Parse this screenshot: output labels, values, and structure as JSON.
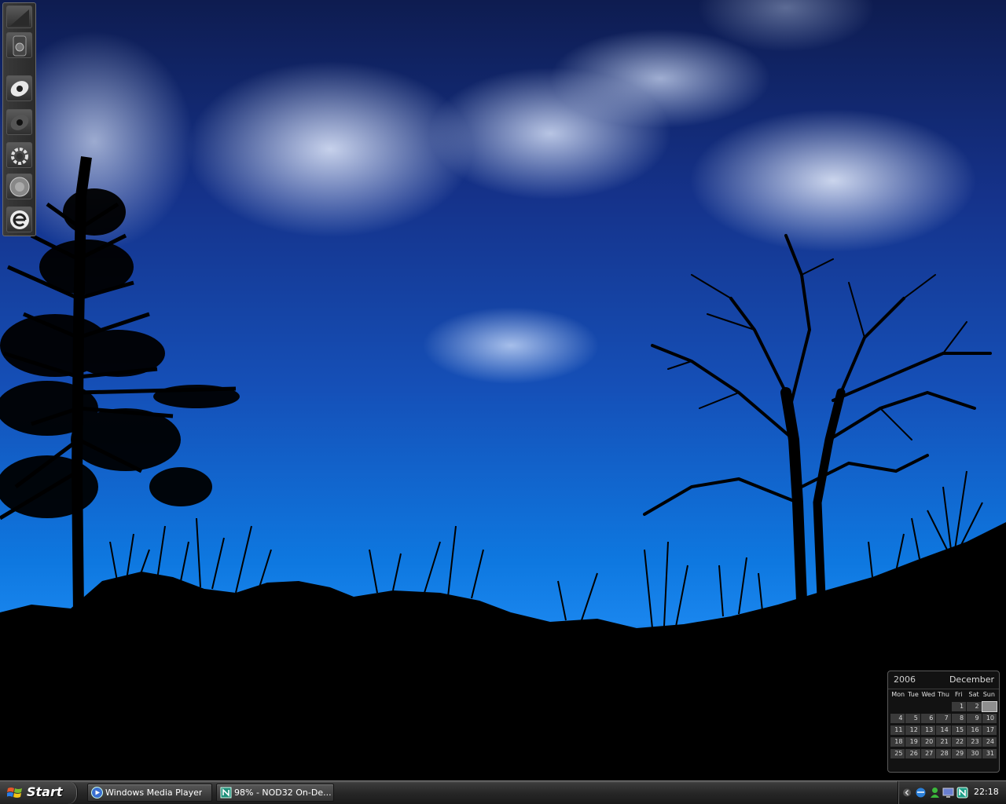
{
  "dock": {
    "items": [
      "ipod-icon",
      "eye-icon",
      "eye-dark-icon",
      "gear-icon",
      "globe-icon",
      "ie-icon"
    ]
  },
  "calendar": {
    "year": "2006",
    "month": "December",
    "days": [
      "Mon",
      "Tue",
      "Wed",
      "Thu",
      "Fri",
      "Sat",
      "Sun"
    ],
    "dates": [
      "",
      "",
      "",
      "",
      "1",
      "2",
      "3",
      "4",
      "5",
      "6",
      "7",
      "8",
      "9",
      "10",
      "11",
      "12",
      "13",
      "14",
      "15",
      "16",
      "17",
      "18",
      "19",
      "20",
      "21",
      "22",
      "23",
      "24",
      "25",
      "26",
      "27",
      "28",
      "29",
      "30",
      "31"
    ],
    "today": "3"
  },
  "taskbar": {
    "start_label": "Start",
    "tasks": [
      {
        "label": "Windows Media Player",
        "icon": "media-player-icon"
      },
      {
        "label": "98% - NOD32 On-De...",
        "icon": "nod32-icon"
      }
    ],
    "tray_icons": [
      "chevron-left-icon",
      "network-icon",
      "messenger-icon",
      "monitor-icon",
      "nod32-tray-icon"
    ],
    "clock": "22:18"
  }
}
